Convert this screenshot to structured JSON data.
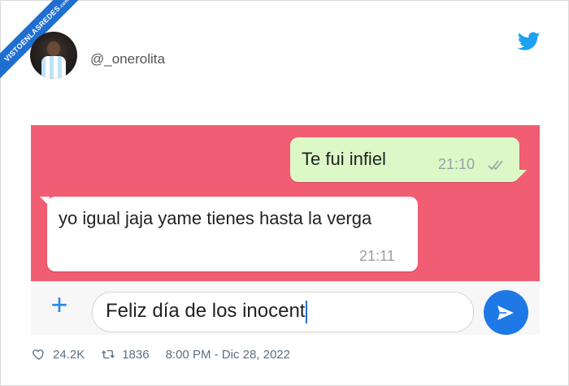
{
  "watermark": {
    "text": "VISTOENLASREDES",
    "suffix": ".com"
  },
  "author": {
    "handle": "@_onerolita"
  },
  "chat": {
    "outgoing": {
      "text": "Te fui infiel",
      "time": "21:10"
    },
    "incoming": {
      "text": "yo igual jaja yame tienes hasta la verga",
      "time": "21:11"
    },
    "input": {
      "value": "Feliz día de los inocent"
    }
  },
  "stats": {
    "likes": "24.2K",
    "retweets": "1836",
    "timestamp": "8:00 PM - Dic 28, 2022"
  },
  "colors": {
    "chat_bg": "#f15d72",
    "outgoing_bubble": "#dcf8c6",
    "send_button": "#1e78e5",
    "twitter_blue": "#1da1f2"
  },
  "icons": [
    "twitter-bird-icon",
    "plus-icon",
    "send-icon",
    "heart-icon",
    "retweet-icon",
    "double-check-icon"
  ]
}
